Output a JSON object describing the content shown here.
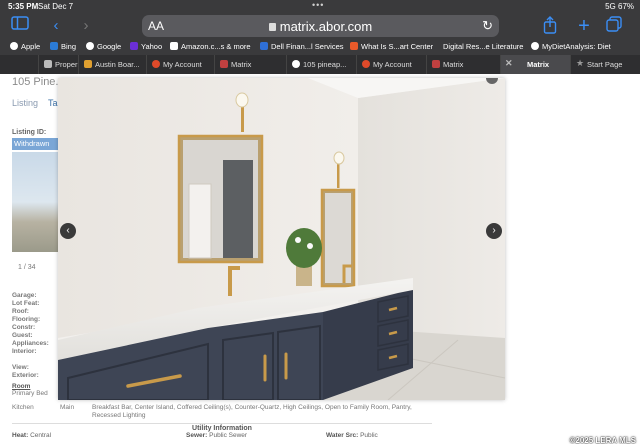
{
  "status_bar": {
    "time": "5:35 PM",
    "date": "Sat Dec 7",
    "right": "5G 67%",
    "dots": "•••"
  },
  "toolbar": {
    "aa_label": "AA",
    "url": "matrix.abor.com",
    "icons": [
      "sidebar-icon",
      "back-icon",
      "forward-icon",
      "reload-icon",
      "share-icon",
      "new-tab-icon",
      "tabs-overview-icon"
    ]
  },
  "bookmarks": [
    {
      "label": "Apple",
      "color": "#ffffff"
    },
    {
      "label": "Bing",
      "color": "#2b7bd6"
    },
    {
      "label": "Google",
      "color": "#ffffff"
    },
    {
      "label": "Yahoo",
      "color": "#6b2fd6"
    },
    {
      "label": "Amazon.c...s & more",
      "color": "#ffffff"
    },
    {
      "label": "Dell Finan...l Services",
      "color": "#2f6fd6"
    },
    {
      "label": "What Is S...art Center",
      "color": "#ea5a2a"
    },
    {
      "label": "Digital Res...e Literature",
      "color": "#3a3a3c"
    },
    {
      "label": "MyDietAnalysis: Diet",
      "color": "#ffffff"
    }
  ],
  "tabs": [
    {
      "label": "Proper",
      "color": "#bbbbbb"
    },
    {
      "label": "Austin Boar...",
      "color": "#e0a030"
    },
    {
      "label": "My Account",
      "color": "#e04a2a"
    },
    {
      "label": "Matrix",
      "color": "#c04040"
    },
    {
      "label": "105 pineap...",
      "color": "#ffffff"
    },
    {
      "label": "My Account",
      "color": "#e04a2a"
    },
    {
      "label": "Matrix",
      "color": "#c04040"
    },
    {
      "label": "Matrix",
      "color": "#c04040"
    },
    {
      "label": "Start Page",
      "color": "#999999"
    }
  ],
  "page": {
    "address": "105 Pine...",
    "tab_listing": "Listing",
    "tab_other": "Ta",
    "listing_id_label": "Listing ID:",
    "status": "Withdrawn",
    "photo_counter": "1 / 34",
    "facts": [
      "Garage:",
      "Lot Feat:",
      "Roof:",
      "Flooring:",
      "Constr:",
      "Guest:",
      "Appliances:",
      "Interior:",
      "View:",
      "Exterior:"
    ],
    "room_header": "Room",
    "room_primary": "Primary Bed",
    "kitchen": {
      "name": "Kitchen",
      "level": "Main",
      "features": "Breakfast Bar, Center Island, Coffered Ceiling(s), Counter-Quartz, High Ceilings, Open to Family Room, Pantry, Recessed Lighting"
    },
    "utility_header": "Utility Information",
    "utilities": {
      "heat_label": "Heat:",
      "heat_value": "Central",
      "sewer_label": "Sewer:",
      "sewer_value": "Public Sewer",
      "water_label": "Water Src:",
      "water_value": "Public"
    },
    "copyright": "©2025 LERA MLS"
  },
  "colors": {
    "chrome_bg": "#3a3a3c",
    "accent": "#3b8ef5",
    "cabinet": "#3e4555",
    "brass": "#c89a4a",
    "status_pill": "#7aa6d6"
  }
}
